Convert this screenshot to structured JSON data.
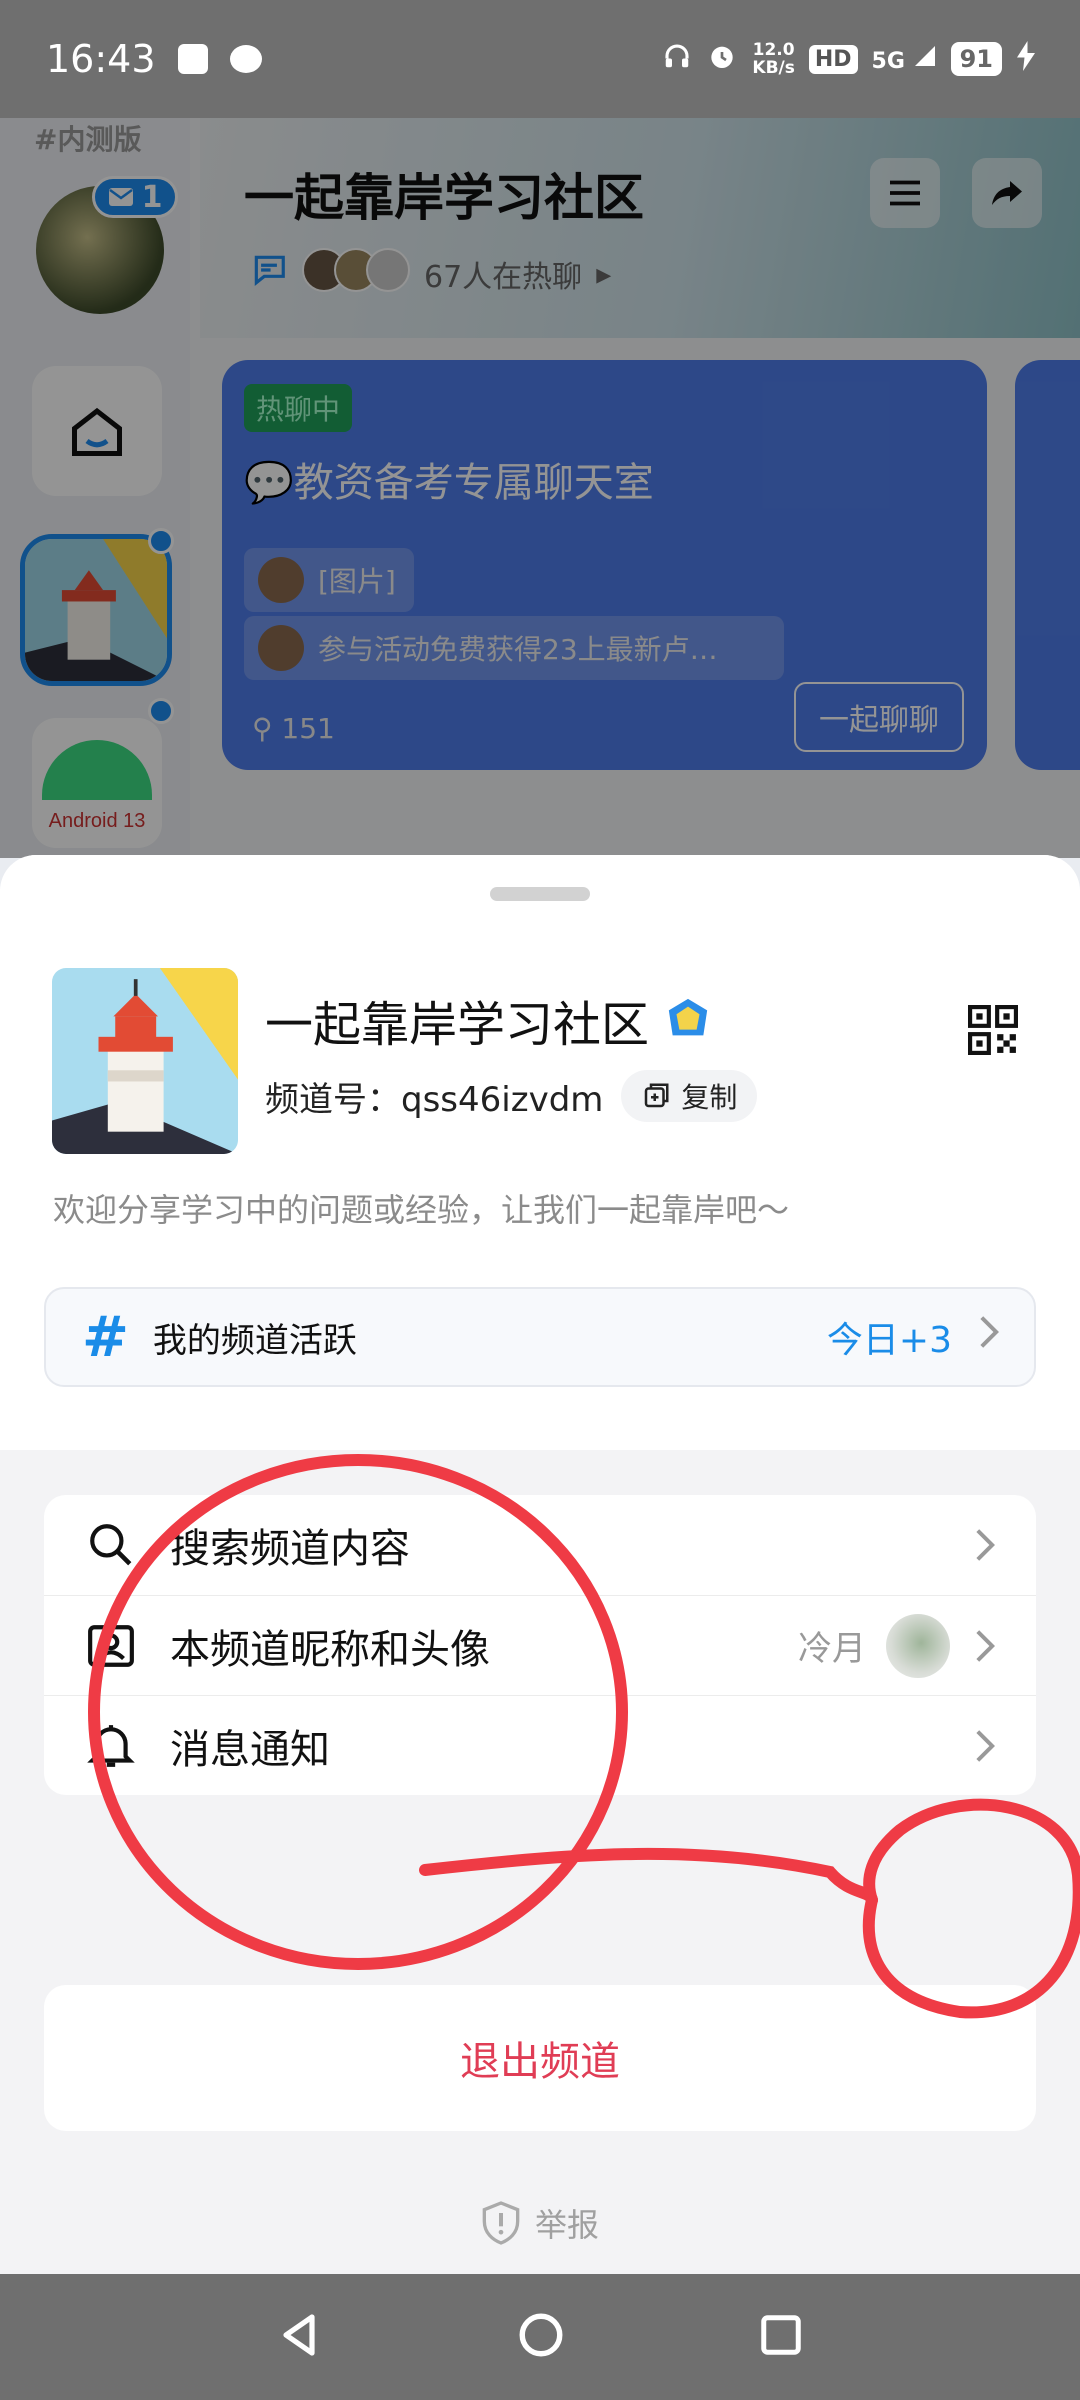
{
  "status_bar": {
    "time": "16:43",
    "net_speed_value": "12.0",
    "net_speed_unit": "KB/s",
    "hd": "HD",
    "signal": "5G",
    "battery": "91"
  },
  "background": {
    "rail_tag": "#内测版",
    "unread_count": "1",
    "android_label": "Android 13",
    "channel_title": "一起靠岸学习社区",
    "online_text": "67人在热聊",
    "chat_card": {
      "tag": "热聊中",
      "title": "💬教资备考专属聊天室",
      "line1": "[图片]",
      "line2": "参与活动免费获得23上最新卢…",
      "count": "151",
      "join_button": "一起聊聊"
    }
  },
  "sheet": {
    "channel_name": "一起靠岸学习社区",
    "channel_id_label": "频道号：",
    "channel_id": "qss46izvdm",
    "copy_label": "复制",
    "description": "欢迎分享学习中的问题或经验，让我们一起靠岸吧～",
    "activity_label": "我的频道活跃",
    "activity_value": "今日+3",
    "menu": {
      "search": "搜索频道内容",
      "nickname": "本频道昵称和头像",
      "nickname_value": "冷月",
      "notify": "消息通知"
    },
    "exit": "退出频道",
    "report": "举报"
  },
  "colors": {
    "accent": "#1a8ce8",
    "danger": "#e03d55",
    "annotation": "#ef3b45"
  },
  "icons": {
    "search": "search-icon",
    "portrait": "portrait-icon",
    "bell": "bell-icon",
    "hash": "hash-icon",
    "qr": "qr-code-icon",
    "shield": "shield-icon"
  }
}
